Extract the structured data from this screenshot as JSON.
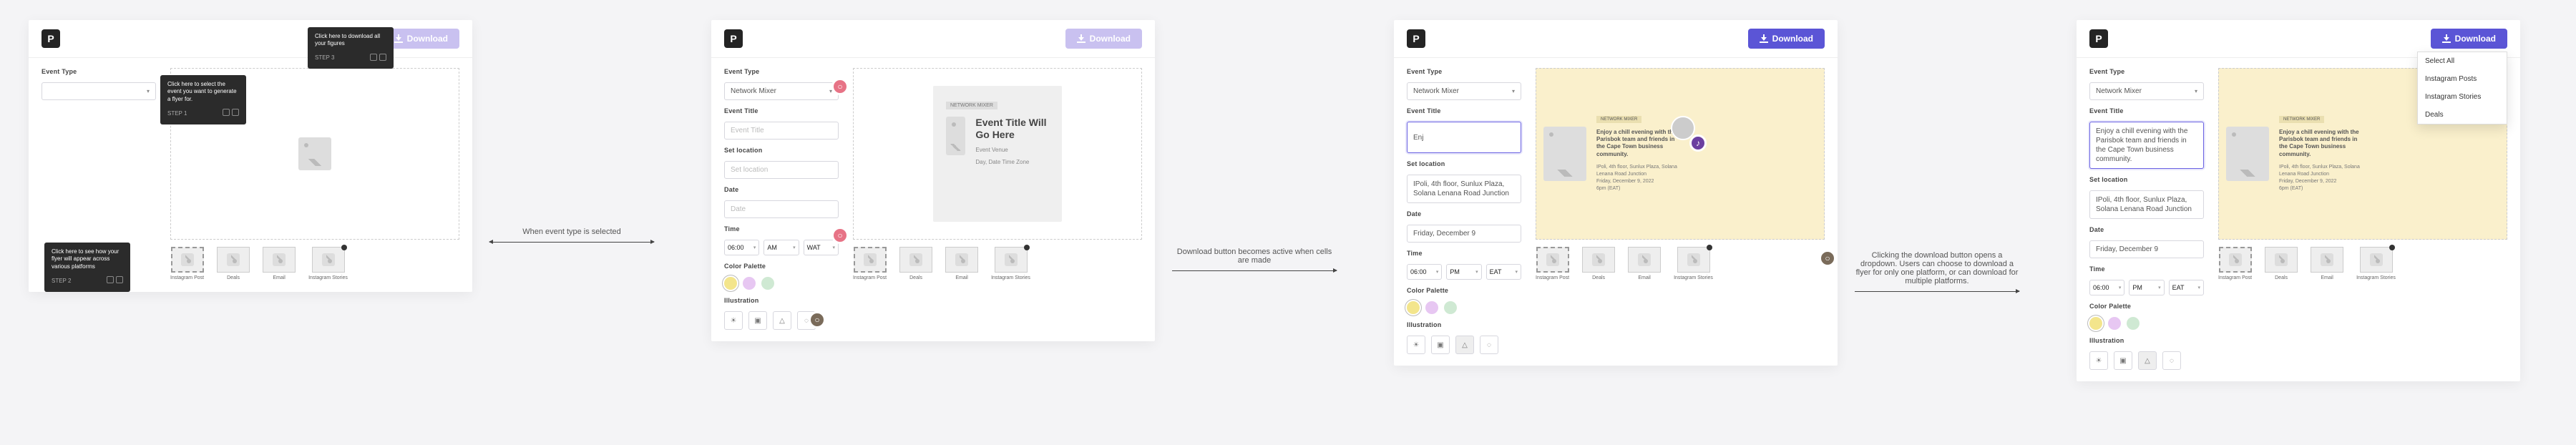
{
  "logo_letter": "P",
  "download_label": "Download",
  "form": {
    "event_type_label": "Event Type",
    "event_type_value": "Network Mixer",
    "event_title_label": "Event Title",
    "event_title_placeholder": "Event Title",
    "event_title_value": "Enjoy a chill evening with the Parisbok team and friends in the Cape Town business community.",
    "event_title_partial": "Enj",
    "location_label": "Set location",
    "location_placeholder": "Set location",
    "location_value": "IPoli, 4th floor, Sunlux Plaza, Solana Lenana Road Junction",
    "date_label": "Date",
    "date_placeholder": "Date",
    "date_value": "Friday, December 9",
    "time_label": "Time",
    "time_hour": "06:00",
    "time_min": "PM",
    "time_tz": "EAT",
    "time_hour_ph": "06:00",
    "time_min_ph": "AM",
    "time_tz_ph": "WAT",
    "palette_label": "Color Palette",
    "illustration_label": "Illustration"
  },
  "palette_colors": [
    "#f3e58c",
    "#e7c7f2",
    "#cfe9d3"
  ],
  "illustrations": [
    "☀",
    "▣",
    "△",
    "◌"
  ],
  "preview": {
    "badge": "NETWORK MIXER",
    "title": "Event Title Will Go Here",
    "sub1": "Event Venue",
    "sub2": "Day, Date   Time Zone",
    "body_bold": "Enjoy a chill evening with the Parisbok team and friends in the Cape Town business community.",
    "body_lines": "IPoli, 4th floor, Sunlux Plaza, Solana Lenana Road Junction\nFriday, December 9, 2022\n6pm (EAT)"
  },
  "platforms": {
    "labels": [
      "Instagram Post",
      "Deals",
      "Email",
      "Instagram Stories"
    ]
  },
  "tooltips": {
    "tip1": {
      "text": "Click here to download all your figures",
      "step": "STEP 3"
    },
    "tip2": {
      "text": "Click here to select the event you want to generate a flyer for.",
      "step": "STEP 1"
    },
    "tip3": {
      "text": "Click here to see how your flyer will appear across various platforms",
      "step": "STEP 2"
    }
  },
  "captions": {
    "c1": "When event type is selected",
    "c2": "Download button becomes active when cells are made",
    "c3": "Clicking the download button opens a dropdown. Users can choose to download a flyer for only one platform, or can download for multiple platforms."
  },
  "dropdown": {
    "opts": [
      "Select All",
      "Instagram Posts",
      "Instagram Stories",
      "Deals"
    ]
  }
}
